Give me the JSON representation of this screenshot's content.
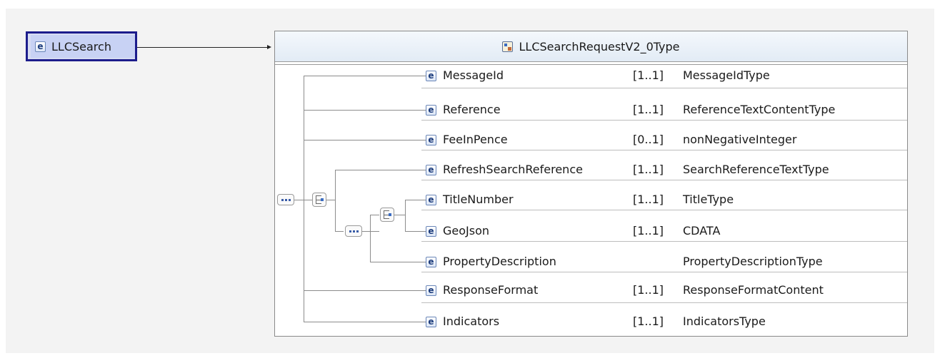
{
  "root_element": {
    "icon": "element-icon",
    "icon_glyph": "e",
    "name": "LLCSearch"
  },
  "complex_type": {
    "icon": "complex-type-icon",
    "name": "LLCSearchRequestV2_0Type"
  },
  "elements": [
    {
      "name": "MessageId",
      "cardinality": "[1..1]",
      "type": "MessageIdType"
    },
    {
      "name": "Reference",
      "cardinality": "[1..1]",
      "type": "ReferenceTextContentType"
    },
    {
      "name": "FeeInPence",
      "cardinality": "[0..1]",
      "type": "nonNegativeInteger"
    },
    {
      "name": "RefreshSearchReference",
      "cardinality": "[1..1]",
      "type": "SearchReferenceTextType"
    },
    {
      "name": "TitleNumber",
      "cardinality": "[1..1]",
      "type": "TitleType"
    },
    {
      "name": "GeoJson",
      "cardinality": "[1..1]",
      "type": "CDATA"
    },
    {
      "name": "PropertyDescription",
      "cardinality": "",
      "type": "PropertyDescriptionType"
    },
    {
      "name": "ResponseFormat",
      "cardinality": "[1..1]",
      "type": "ResponseFormatContent"
    },
    {
      "name": "Indicators",
      "cardinality": "[1..1]",
      "type": "IndicatorsType"
    }
  ],
  "compositors": [
    "sequence-icon",
    "choice-icon",
    "sequence-icon",
    "choice-icon"
  ],
  "colors": {
    "root_border": "#1c1c8c",
    "root_fill": "#c8d2f4",
    "background": "#f3f3f3"
  }
}
